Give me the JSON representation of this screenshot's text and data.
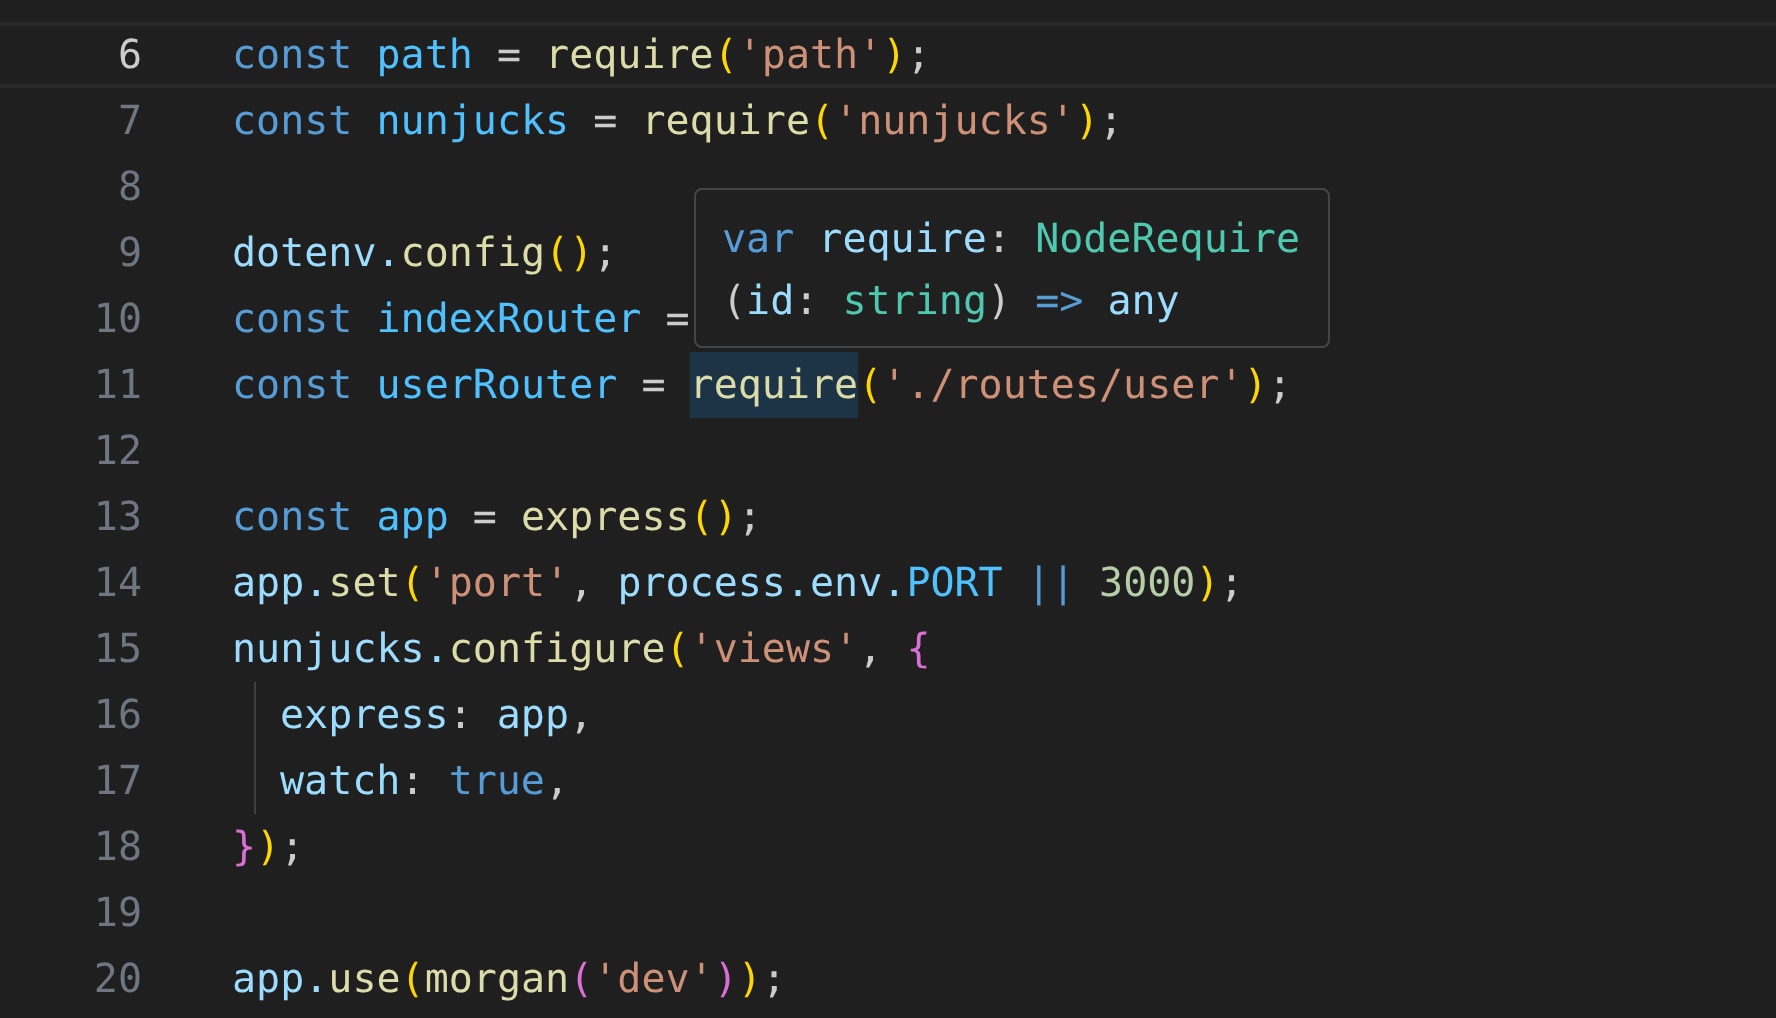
{
  "editor": {
    "lines": [
      {
        "number": "6",
        "selected": true,
        "indented": false,
        "tokens": [
          {
            "kind": "keyword",
            "text": "const "
          },
          {
            "kind": "variable",
            "text": "path"
          },
          {
            "kind": "punct",
            "text": " = "
          },
          {
            "kind": "function",
            "text": "require"
          },
          {
            "kind": "bracket1",
            "text": "("
          },
          {
            "kind": "string",
            "text": "'path'"
          },
          {
            "kind": "bracket1",
            "text": ")"
          },
          {
            "kind": "punct",
            "text": ";"
          }
        ]
      },
      {
        "number": "7",
        "selected": false,
        "indented": false,
        "tokens": [
          {
            "kind": "keyword",
            "text": "const "
          },
          {
            "kind": "variable",
            "text": "nunjucks"
          },
          {
            "kind": "punct",
            "text": " = "
          },
          {
            "kind": "function",
            "text": "require"
          },
          {
            "kind": "bracket1",
            "text": "("
          },
          {
            "kind": "string",
            "text": "'nunjucks'"
          },
          {
            "kind": "bracket1",
            "text": ")"
          },
          {
            "kind": "punct",
            "text": ";"
          }
        ]
      },
      {
        "number": "8",
        "selected": false,
        "indented": false
      },
      {
        "number": "9",
        "selected": false,
        "indented": false,
        "tokens": [
          {
            "kind": "property",
            "text": "dotenv."
          },
          {
            "kind": "function",
            "text": "config"
          },
          {
            "kind": "bracket1",
            "text": "()"
          },
          {
            "kind": "punct",
            "text": ";"
          }
        ]
      },
      {
        "number": "10",
        "selected": false,
        "indented": false,
        "tokens": [
          {
            "kind": "keyword",
            "text": "const "
          },
          {
            "kind": "variable",
            "text": "indexRouter"
          },
          {
            "kind": "punct",
            "text": " ="
          }
        ]
      },
      {
        "number": "11",
        "selected": false,
        "indented": false,
        "tokens": [
          {
            "kind": "keyword",
            "text": "const "
          },
          {
            "kind": "variable",
            "text": "userRouter"
          },
          {
            "kind": "punct",
            "text": " = "
          },
          {
            "kind": "function",
            "text": "require",
            "highlighted": true
          },
          {
            "kind": "bracket1",
            "text": "("
          },
          {
            "kind": "string",
            "text": "'./routes/user'"
          },
          {
            "kind": "bracket1",
            "text": ")"
          },
          {
            "kind": "punct",
            "text": ";"
          }
        ]
      },
      {
        "number": "12",
        "selected": false,
        "indented": false
      },
      {
        "number": "13",
        "selected": false,
        "indented": false,
        "tokens": [
          {
            "kind": "keyword",
            "text": "const "
          },
          {
            "kind": "variable",
            "text": "app"
          },
          {
            "kind": "punct",
            "text": " = "
          },
          {
            "kind": "function",
            "text": "express"
          },
          {
            "kind": "bracket1",
            "text": "()"
          },
          {
            "kind": "punct",
            "text": ";"
          }
        ]
      },
      {
        "number": "14",
        "selected": false,
        "indented": false,
        "tokens": [
          {
            "kind": "property",
            "text": "app."
          },
          {
            "kind": "function",
            "text": "set"
          },
          {
            "kind": "bracket1",
            "text": "("
          },
          {
            "kind": "string",
            "text": "'port'"
          },
          {
            "kind": "punct",
            "text": ", "
          },
          {
            "kind": "property",
            "text": "process.env."
          },
          {
            "kind": "variable",
            "text": "PORT "
          },
          {
            "kind": "operator",
            "text": "|| "
          },
          {
            "kind": "number",
            "text": "3000"
          },
          {
            "kind": "bracket1",
            "text": ")"
          },
          {
            "kind": "punct",
            "text": ";"
          }
        ]
      },
      {
        "number": "15",
        "selected": false,
        "indented": false,
        "tokens": [
          {
            "kind": "property",
            "text": "nunjucks."
          },
          {
            "kind": "function",
            "text": "configure"
          },
          {
            "kind": "bracket1",
            "text": "("
          },
          {
            "kind": "string",
            "text": "'views'"
          },
          {
            "kind": "punct",
            "text": ", "
          },
          {
            "kind": "bracket2",
            "text": "{"
          }
        ]
      },
      {
        "number": "16",
        "selected": false,
        "indented": true,
        "tokens": [
          {
            "kind": "property",
            "text": "express"
          },
          {
            "kind": "punct",
            "text": ": "
          },
          {
            "kind": "property",
            "text": "app"
          },
          {
            "kind": "punct",
            "text": ","
          }
        ]
      },
      {
        "number": "17",
        "selected": false,
        "indented": true,
        "tokens": [
          {
            "kind": "property",
            "text": "watch"
          },
          {
            "kind": "punct",
            "text": ": "
          },
          {
            "kind": "keyword",
            "text": "true"
          },
          {
            "kind": "punct",
            "text": ","
          }
        ]
      },
      {
        "number": "18",
        "selected": false,
        "indented": false,
        "tokens": [
          {
            "kind": "bracket2",
            "text": "}"
          },
          {
            "kind": "bracket1",
            "text": ")"
          },
          {
            "kind": "punct",
            "text": ";"
          }
        ]
      },
      {
        "number": "19",
        "selected": false,
        "indented": false
      },
      {
        "number": "20",
        "selected": false,
        "indented": false,
        "tokens": [
          {
            "kind": "property",
            "text": "app."
          },
          {
            "kind": "function",
            "text": "use"
          },
          {
            "kind": "bracket1",
            "text": "("
          },
          {
            "kind": "function",
            "text": "morgan"
          },
          {
            "kind": "bracket2",
            "text": "("
          },
          {
            "kind": "string",
            "text": "'dev'"
          },
          {
            "kind": "bracket2",
            "text": ")"
          },
          {
            "kind": "bracket1",
            "text": ")"
          },
          {
            "kind": "punct",
            "text": ";"
          }
        ]
      }
    ]
  },
  "hover": {
    "lines": [
      [
        {
          "kind": "keyword",
          "text": "var "
        },
        {
          "kind": "property",
          "text": "require"
        },
        {
          "kind": "punct",
          "text": ": "
        },
        {
          "kind": "type",
          "text": "NodeRequire"
        }
      ],
      [
        {
          "kind": "punct",
          "text": "("
        },
        {
          "kind": "property",
          "text": "id"
        },
        {
          "kind": "punct",
          "text": ": "
        },
        {
          "kind": "type",
          "text": "string"
        },
        {
          "kind": "punct",
          "text": ") "
        },
        {
          "kind": "keyword",
          "text": "=> "
        },
        {
          "kind": "property",
          "text": "any"
        }
      ]
    ]
  }
}
